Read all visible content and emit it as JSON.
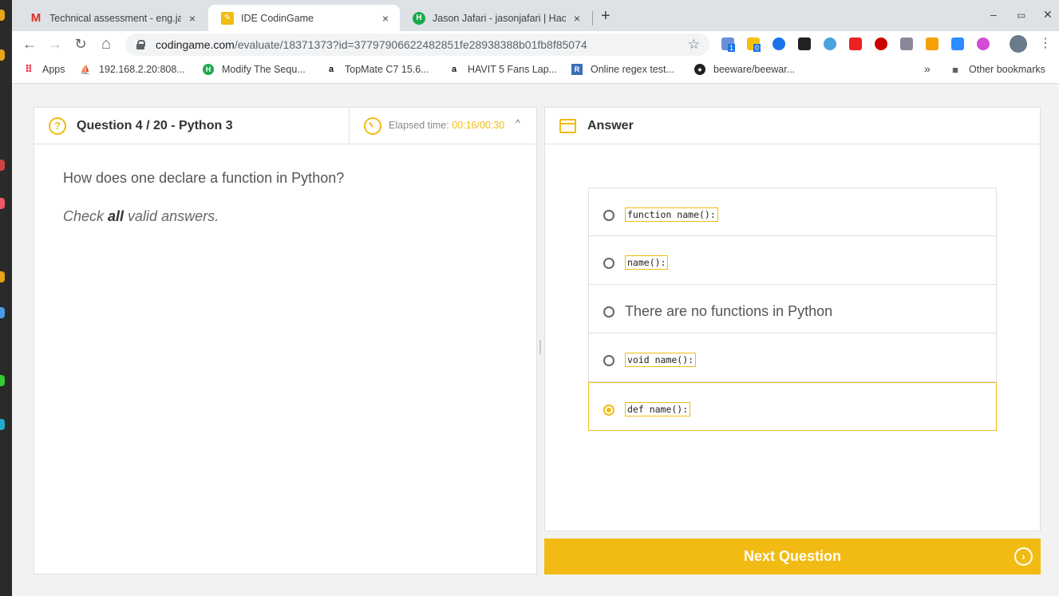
{
  "tabs": [
    {
      "title": "Technical assessment - eng.jaf",
      "favicon": "gmail-icon"
    },
    {
      "title": "IDE CodinGame",
      "favicon": "codingame-icon"
    },
    {
      "title": "Jason Jafari - jasonjafari | Hac",
      "favicon": "hackerrank-icon"
    }
  ],
  "tab_close": "×",
  "new_tab": "+",
  "window_controls": {
    "minimize": "–",
    "maximize": "▭",
    "close": "✕"
  },
  "nav": {
    "back": "←",
    "forward": "→",
    "reload": "↻",
    "home": "⌂"
  },
  "url": {
    "host": "codingame.com",
    "path": "/evaluate/18371373?id=37797906622482851fe28938388b01fb8f85074"
  },
  "star": "☆",
  "extensions": {
    "badge1": "1",
    "badge2": "0"
  },
  "menu": "⋮",
  "bookmarks": [
    {
      "label": "Apps",
      "icon": "apps-grid-icon"
    },
    {
      "label": "192.168.2.20:808...",
      "icon": "phpmyadmin-icon"
    },
    {
      "label": "Modify The Sequ...",
      "icon": "hackerrank-icon"
    },
    {
      "label": "TopMate C7 15.6...",
      "icon": "amazon-icon"
    },
    {
      "label": "HAVIT 5 Fans Lap...",
      "icon": "amazon-icon"
    },
    {
      "label": "Online regex test...",
      "icon": "regex-icon"
    },
    {
      "label": "beeware/beewar...",
      "icon": "github-icon"
    }
  ],
  "bookmarks_overflow": "»",
  "other_bookmarks": "Other bookmarks",
  "question": {
    "icon": "?",
    "title": "Question 4 / 20 - Python 3",
    "elapsed_label": "Elapsed time: ",
    "elapsed_value": "00:16/00:30",
    "chevron": "^",
    "text": "How does one declare a function in Python?",
    "hint_pre": "Check ",
    "hint_bold": "all",
    "hint_post": " valid answers."
  },
  "answer": {
    "title": "Answer",
    "icon": "<>",
    "options": [
      {
        "text": "function name():",
        "code": true,
        "selected": false
      },
      {
        "text": "name():",
        "code": true,
        "selected": false
      },
      {
        "text": "There are no functions in Python",
        "code": false,
        "selected": false
      },
      {
        "text": "void name():",
        "code": true,
        "selected": false
      },
      {
        "text": "def name():",
        "code": true,
        "selected": true
      }
    ]
  },
  "next_button": "Next Question",
  "next_arrow": "›",
  "colors": {
    "accent": "#f2bb13"
  }
}
